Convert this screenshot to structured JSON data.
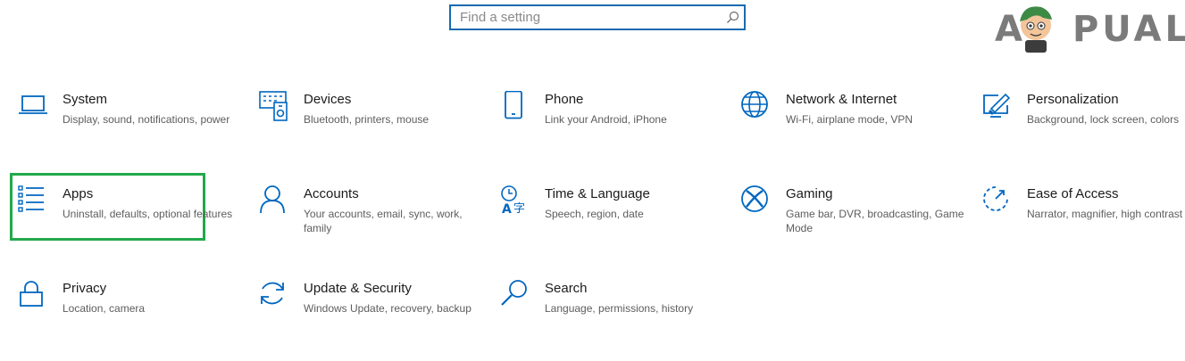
{
  "search": {
    "placeholder": "Find a setting",
    "value": ""
  },
  "logo": {
    "text": "APPUALS"
  },
  "accent_color": "#0067c0",
  "highlight_color": "#22a94a",
  "settings": [
    {
      "title": "System",
      "desc": "Display, sound, notifications, power",
      "icon": "laptop-icon"
    },
    {
      "title": "Devices",
      "desc": "Bluetooth, printers, mouse",
      "icon": "devices-icon"
    },
    {
      "title": "Phone",
      "desc": "Link your Android, iPhone",
      "icon": "phone-icon"
    },
    {
      "title": "Network & Internet",
      "desc": "Wi-Fi, airplane mode, VPN",
      "icon": "globe-icon"
    },
    {
      "title": "Personalization",
      "desc": "Background, lock screen, colors",
      "icon": "paint-icon"
    },
    {
      "title": "Apps",
      "desc": "Uninstall, defaults, optional features",
      "icon": "apps-list-icon",
      "highlighted": true
    },
    {
      "title": "Accounts",
      "desc": "Your accounts, email, sync, work, family",
      "icon": "person-icon"
    },
    {
      "title": "Time & Language",
      "desc": "Speech, region, date",
      "icon": "time-language-icon"
    },
    {
      "title": "Gaming",
      "desc": "Game bar, DVR, broadcasting, Game Mode",
      "icon": "xbox-icon"
    },
    {
      "title": "Ease of Access",
      "desc": "Narrator, magnifier, high contrast",
      "icon": "ease-of-access-icon"
    },
    {
      "title": "Privacy",
      "desc": "Location, camera",
      "icon": "lock-icon"
    },
    {
      "title": "Update & Security",
      "desc": "Windows Update, recovery, backup",
      "icon": "sync-icon"
    },
    {
      "title": "Search",
      "desc": "Language, permissions, history",
      "icon": "search-icon"
    }
  ]
}
